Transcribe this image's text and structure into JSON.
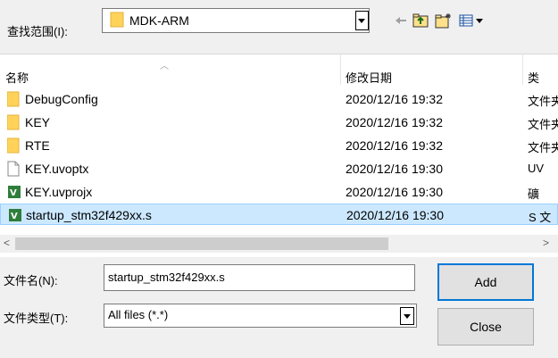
{
  "lookin": {
    "label": "查找范围(I):",
    "value": "MDK-ARM"
  },
  "toolbar": {
    "back_icon": "back-arrow-icon",
    "up_icon": "up-folder-icon",
    "new_folder_icon": "new-folder-icon",
    "view_icon": "view-menu-icon"
  },
  "columns": {
    "name": "名称",
    "date": "修改日期",
    "type": "类"
  },
  "files": [
    {
      "name": "DebugConfig",
      "date": "2020/12/16 19:32",
      "type": "文件夹",
      "icon": "folder-icon"
    },
    {
      "name": "KEY",
      "date": "2020/12/16 19:32",
      "type": "文件夹",
      "icon": "folder-icon"
    },
    {
      "name": "RTE",
      "date": "2020/12/16 19:32",
      "type": "文件夹",
      "icon": "folder-icon"
    },
    {
      "name": "KEY.uvoptx",
      "date": "2020/12/16 19:30",
      "type": "UV",
      "icon": "file-icon"
    },
    {
      "name": "KEY.uvprojx",
      "date": "2020/12/16 19:30",
      "type": "礦",
      "icon": "keil-icon"
    },
    {
      "name": "startup_stm32f429xx.s",
      "date": "2020/12/16 19:30",
      "type": "S 文",
      "icon": "keil-icon"
    }
  ],
  "filename": {
    "label": "文件名(N):",
    "value": "startup_stm32f429xx.s"
  },
  "filetype": {
    "label": "文件类型(T):",
    "value": "All files (*.*)"
  },
  "buttons": {
    "add": "Add",
    "close": "Close"
  },
  "colors": {
    "selection_bg": "#cce8ff",
    "selection_border": "#99d1ff",
    "folder": "#ffd35a",
    "accent": "#0078d7"
  }
}
